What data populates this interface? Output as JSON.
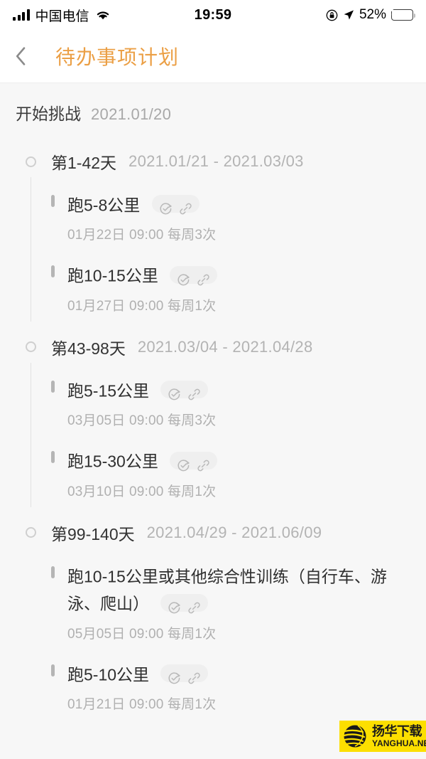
{
  "status_bar": {
    "carrier": "中国电信",
    "time": "19:59",
    "battery_percent": "52%",
    "icons": [
      "signal-bars-icon",
      "wifi-icon",
      "rotation-lock-icon",
      "location-arrow-icon",
      "battery-charging-icon"
    ]
  },
  "nav": {
    "back_icon": "chevron-left-icon",
    "title": "待办事项计划",
    "title_color": "#eb9f45"
  },
  "start": {
    "label": "开始挑战",
    "date": "2021.01/20"
  },
  "phases": [
    {
      "title": "第1-42天",
      "range": "2021.01/21 - 2021.03/03",
      "has_connector": true,
      "tasks": [
        {
          "title": "跑5-8公里",
          "sub": "01月22日 09:00 每周3次",
          "badges": [
            "repeat-check-icon",
            "link-icon"
          ]
        },
        {
          "title": "跑10-15公里",
          "sub": "01月27日 09:00 每周1次",
          "badges": [
            "repeat-check-icon",
            "link-icon"
          ]
        }
      ]
    },
    {
      "title": "第43-98天",
      "range": "2021.03/04 - 2021.04/28",
      "has_connector": true,
      "tasks": [
        {
          "title": "跑5-15公里",
          "sub": "03月05日 09:00 每周3次",
          "badges": [
            "repeat-check-icon",
            "link-icon"
          ]
        },
        {
          "title": "跑15-30公里",
          "sub": "03月10日 09:00 每周1次",
          "badges": [
            "repeat-check-icon",
            "link-icon"
          ]
        }
      ]
    },
    {
      "title": "第99-140天",
      "range": "2021.04/29 - 2021.06/09",
      "has_connector": false,
      "tasks": [
        {
          "title": "跑10-15公里或其他综合性训练（自行车、游泳、爬山）",
          "sub": "05月05日 09:00 每周1次",
          "badges": [
            "repeat-check-icon",
            "link-icon"
          ]
        },
        {
          "title": "跑5-10公里",
          "sub": "01月21日 09:00 每周1次",
          "badges": [
            "repeat-check-icon",
            "link-icon"
          ]
        }
      ]
    }
  ],
  "watermark": {
    "cn": "扬华下载",
    "en": "YANGHUA.NET",
    "bg_color": "#fcdf00"
  }
}
